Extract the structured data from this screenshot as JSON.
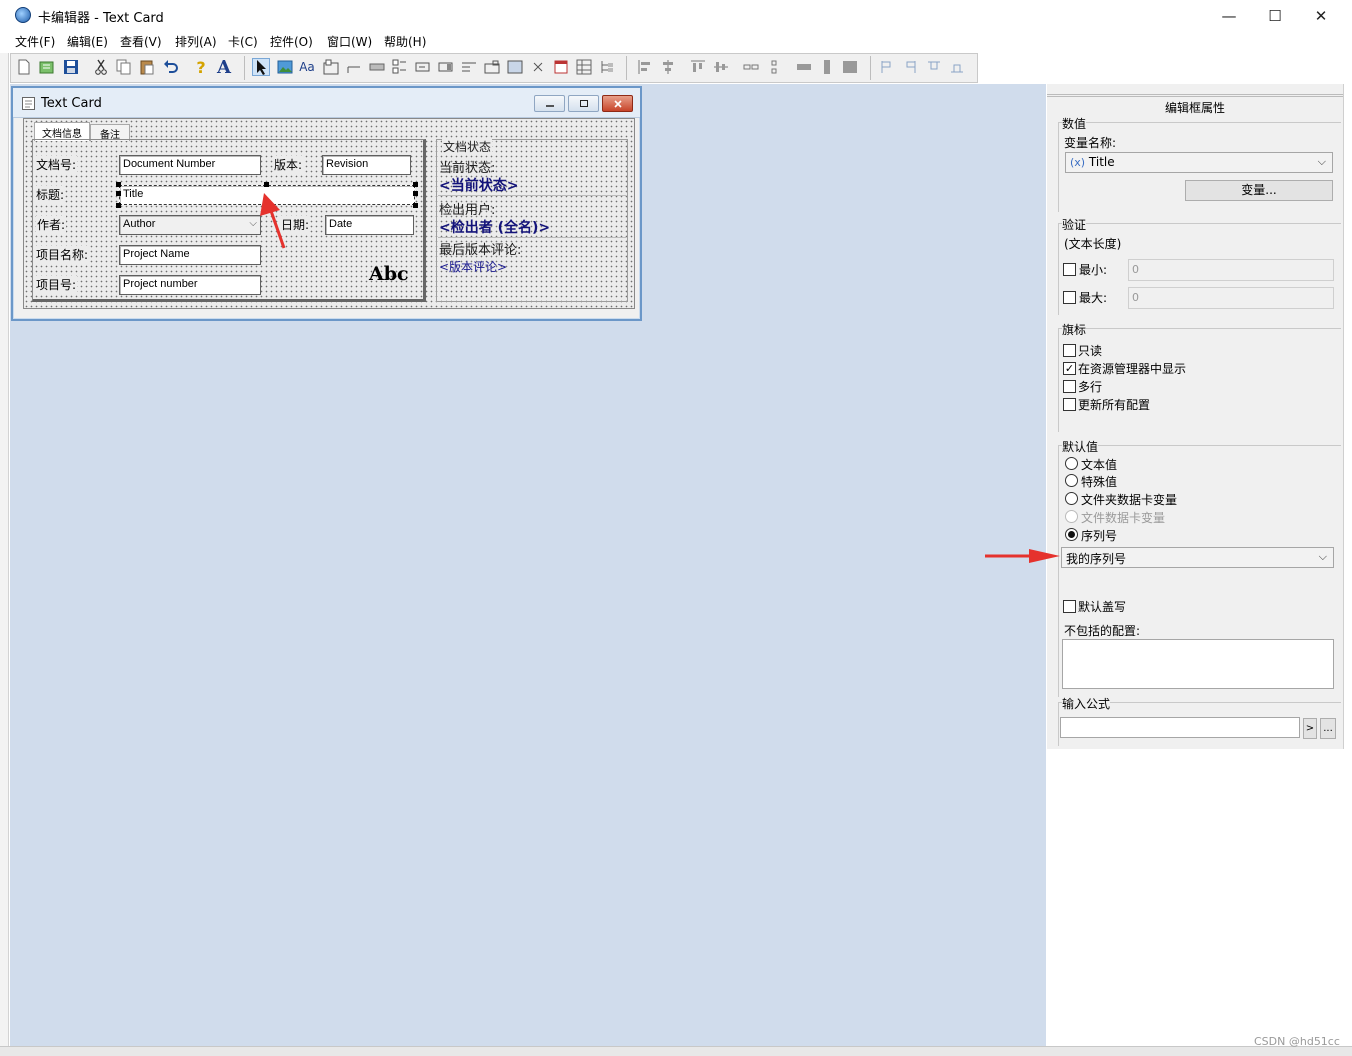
{
  "window": {
    "title": "卡编辑器 - Text Card",
    "controls": {
      "minimize": "—",
      "maximize": "☐",
      "close": "✕"
    }
  },
  "menu": [
    "文件(F)",
    "编辑(E)",
    "查看(V)",
    "排列(A)",
    "卡(C)",
    "控件(O)",
    "窗口(W)",
    "帮助(H)"
  ],
  "toolbar": {
    "icons": [
      "new-icon",
      "open-icon",
      "save-icon",
      "cut-icon",
      "copy-icon",
      "paste-icon",
      "undo-icon",
      "help-icon",
      "font-icon",
      "pointer-icon",
      "image-icon",
      "label-icon",
      "frame-icon",
      "line-icon",
      "edit-box-icon",
      "checkbox-icon",
      "radio-icon",
      "combo-icon",
      "list-icon",
      "tab-icon",
      "panel-icon",
      "x-icon",
      "date-icon",
      "grid-icon",
      "tree-icon",
      "align-left-icon",
      "align-center-icon",
      "align-top-icon",
      "align-middle-icon",
      "link-icon",
      "spacing-icon",
      "same-width-icon",
      "same-height-icon",
      "same-size-icon",
      "flag-left-icon",
      "flag-right-icon",
      "flag-top-icon",
      "flag-bottom-icon"
    ],
    "help_glyph": "?",
    "font_glyph": "A",
    "label_glyph": "Aa"
  },
  "card": {
    "title": "Text Card",
    "tabs": [
      "文档信息",
      "备注"
    ],
    "labels": {
      "doc_number": "文档号:",
      "title": "标题:",
      "author": "作者:",
      "project_name": "项目名称:",
      "project_number": "项目号:",
      "revision": "版本:",
      "date": "日期:"
    },
    "fields": {
      "doc_number": "Document Number",
      "revision": "Revision",
      "title": "Title",
      "author": "Author",
      "date": "Date",
      "project_name": "Project Name",
      "project_number": "Project number"
    },
    "abc": "Abc",
    "status": {
      "heading": "文档状态",
      "current_label": "当前状态:",
      "current_value": "<当前状态>",
      "checked_out_label": "检出用户:",
      "checked_out_value": "<检出者 (全名)>",
      "last_comment_label": "最后版本评论:",
      "last_comment_value": "<版本评论>"
    }
  },
  "panel": {
    "title": "编辑框属性",
    "value_group": "数值",
    "var_name_label": "变量名称:",
    "var_prefix": "(x)",
    "var_value": "Title",
    "var_button": "变量...",
    "validation_group": "验证",
    "text_length": "(文本长度)",
    "min_label": "最小:",
    "min_value": "0",
    "max_label": "最大:",
    "max_value": "0",
    "flags_group": "旗标",
    "flags": [
      {
        "label": "只读",
        "checked": false
      },
      {
        "label": "在资源管理器中显示",
        "checked": true
      },
      {
        "label": "多行",
        "checked": false
      },
      {
        "label": "更新所有配置",
        "checked": false
      }
    ],
    "default_group": "默认值",
    "defaults": [
      {
        "label": "文本值",
        "selected": false,
        "disabled": false
      },
      {
        "label": "特殊值",
        "selected": false,
        "disabled": false
      },
      {
        "label": "文件夹数据卡变量",
        "selected": false,
        "disabled": false
      },
      {
        "label": "文件数据卡变量",
        "selected": false,
        "disabled": true
      },
      {
        "label": "序列号",
        "selected": true,
        "disabled": false
      }
    ],
    "serial_value": "我的序列号",
    "default_overwrite": "默认盖写",
    "excluded_label": "不包括的配置:",
    "formula_group": "输入公式",
    "formula_btn1": ">",
    "formula_btn2": "..."
  },
  "watermark": "CSDN @hd51cc",
  "colors": {
    "workspace": "#d0dcec",
    "accent_arrow": "#e5322d",
    "status_text": "#13137a"
  }
}
